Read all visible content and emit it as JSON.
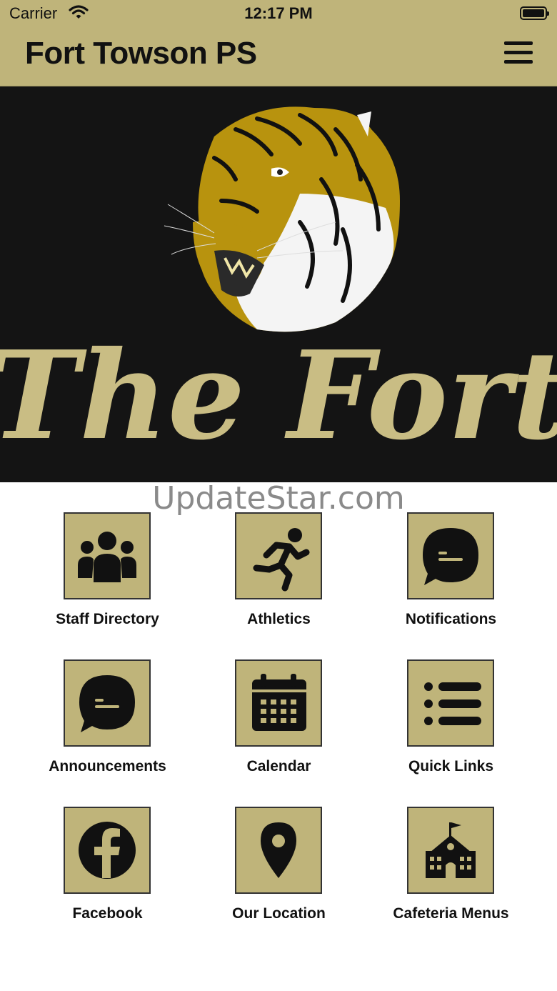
{
  "status_bar": {
    "carrier": "Carrier",
    "time": "12:17 PM"
  },
  "header": {
    "title": "Fort Towson PS"
  },
  "hero": {
    "banner_text": "The Fort"
  },
  "watermark": "UpdateStar.com",
  "grid": {
    "items": [
      {
        "label": "Staff Directory",
        "icon": "staff-icon"
      },
      {
        "label": "Athletics",
        "icon": "runner-icon"
      },
      {
        "label": "Notifications",
        "icon": "chat-bubble-icon"
      },
      {
        "label": "Announcements",
        "icon": "chat-bubble-icon"
      },
      {
        "label": "Calendar",
        "icon": "calendar-icon"
      },
      {
        "label": "Quick Links",
        "icon": "list-icon"
      },
      {
        "label": "Facebook",
        "icon": "facebook-icon"
      },
      {
        "label": "Our Location",
        "icon": "map-pin-icon"
      },
      {
        "label": "Cafeteria Menus",
        "icon": "school-building-icon"
      }
    ]
  },
  "colors": {
    "brand_gold": "#bfb47a",
    "hero_bg": "#141414",
    "tiger_gold": "#b8930e",
    "script_gold": "#c9bd84"
  }
}
